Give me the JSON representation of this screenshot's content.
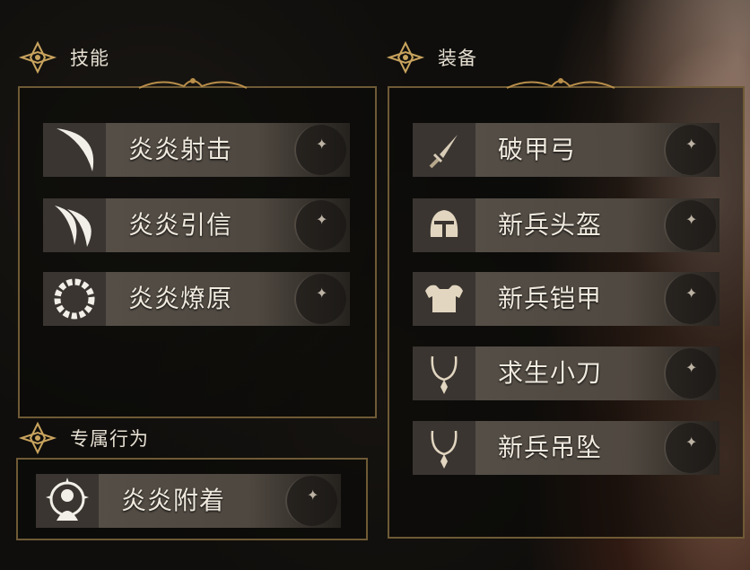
{
  "sections": {
    "skills": {
      "title": "技能"
    },
    "equipment": {
      "title": "装备"
    },
    "exclusive": {
      "title": "专属行为"
    }
  },
  "skills": [
    {
      "label": "炎炎射击",
      "icon": "crescent-slash-icon"
    },
    {
      "label": "炎炎引信",
      "icon": "double-crescent-icon"
    },
    {
      "label": "炎炎燎原",
      "icon": "flame-ring-icon"
    }
  ],
  "equipment": [
    {
      "label": "破甲弓",
      "icon": "dagger-icon"
    },
    {
      "label": "新兵头盔",
      "icon": "helmet-icon"
    },
    {
      "label": "新兵铠甲",
      "icon": "armor-icon"
    },
    {
      "label": "求生小刀",
      "icon": "necklace-icon"
    },
    {
      "label": "新兵吊坠",
      "icon": "pendant-icon"
    }
  ],
  "exclusive_actions": [
    {
      "label": "炎炎附着",
      "icon": "halo-figure-icon"
    }
  ],
  "colors": {
    "frame": "#6e5a35",
    "row": "#5f5850",
    "text": "#efe9de"
  }
}
